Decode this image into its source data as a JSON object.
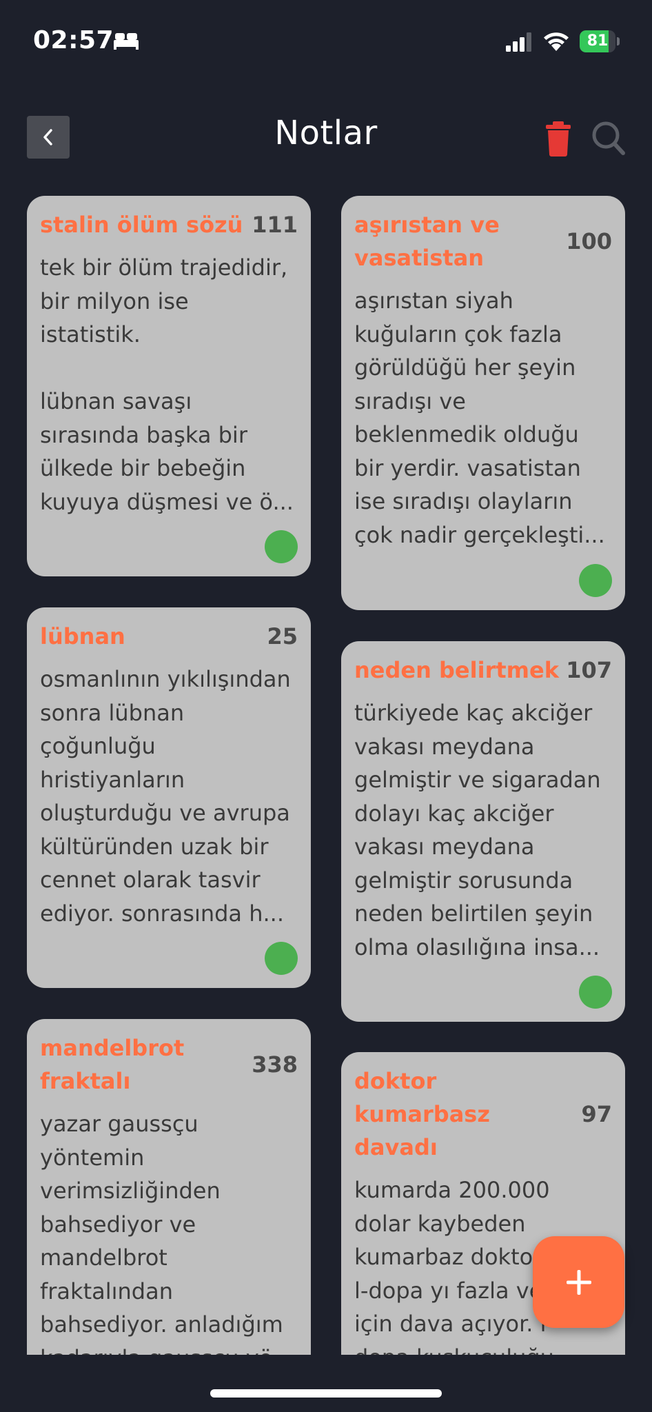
{
  "status_bar": {
    "time": "02:57",
    "battery_percent": "81",
    "battery_level": 0.81,
    "icons": [
      "bed-icon",
      "signal-icon",
      "wifi-icon",
      "battery-icon"
    ]
  },
  "header": {
    "title": "Notlar",
    "back_icon": "chevron-left-icon",
    "trash_icon": "trash-icon",
    "search_icon": "search-icon"
  },
  "colors": {
    "background": "#1d202b",
    "card": "#c0c0c0",
    "accent": "#ff7043",
    "status_dot": "#4caf50",
    "trash": "#e53935"
  },
  "notes": [
    {
      "title": "stalin ölüm sözü",
      "count": "111",
      "body": "tek bir ölüm trajedidir,\nbir milyon ise\nistatistik.\n\nlübnan savaşı\nsırasında başka bir\nülkede bir bebeğin\nkuyuya düşmesi ve ö..."
    },
    {
      "title": "aşırıstan ve vasatistan",
      "count": "100",
      "body": "aşırıstan siyah\nkuğuların çok fazla\ngörüldüğü her şeyin\nsıradışı ve\nbeklenmedik olduğu\nbir yerdir. vasatistan\nise sıradışı olayların\nçok nadir gerçekleşti..."
    },
    {
      "title": "lübnan",
      "count": "25",
      "body": "osmanlının yıkılışından\nsonra lübnan\nçoğunluğu\nhristiyanların\noluşturduğu ve avrupa\nkültüründen uzak bir\ncennet olarak tasvir\nediyor. sonrasında h..."
    },
    {
      "title": "neden belirtmek",
      "count": "107",
      "body": "türkiyede kaç akciğer\nvakası meydana\ngelmiştir ve sigaradan\ndolayı kaç akciğer\nvakası meydana\ngelmiştir sorusunda\nneden belirtilen şeyin\nolma olasılığına insa..."
    },
    {
      "title": "mandelbrot fraktalı",
      "count": "338",
      "body": "yazar gaussçu\nyöntemin\nverimsizliğinden\nbahsediyor ve\nmandelbrot\nfraktalından\nbahsediyor. anladığım\nkadarıyla gaussçu yö..."
    },
    {
      "title": "doktor kumarbasz davadı",
      "count": "97",
      "body": "kumarda 200.000\ndolar kaybeden\nkumarbaz doktoruna\nl-dopa yı fazla verdiği\niçin dava açıyor. l-\ndopa kuşkuculuğu\nazaltıyor ve kumarda..."
    }
  ],
  "fab": {
    "icon": "plus-icon",
    "label": "+"
  }
}
